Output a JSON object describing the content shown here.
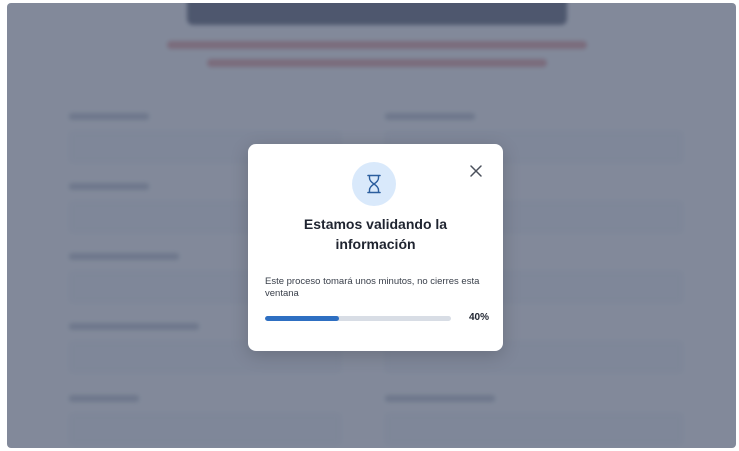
{
  "modal": {
    "title_line1": "Estamos validando la",
    "title_line2": "información",
    "description": "Este proceso tomará unos minutos, no cierres esta ventana",
    "progress_fraction": 0.4,
    "progress_label": "40%",
    "icon": "hourglass-icon",
    "close_icon": "close-icon"
  },
  "colors": {
    "accent": "#2e6fc2",
    "icon_bg": "#d9e9fb",
    "overlay": "#566076"
  }
}
